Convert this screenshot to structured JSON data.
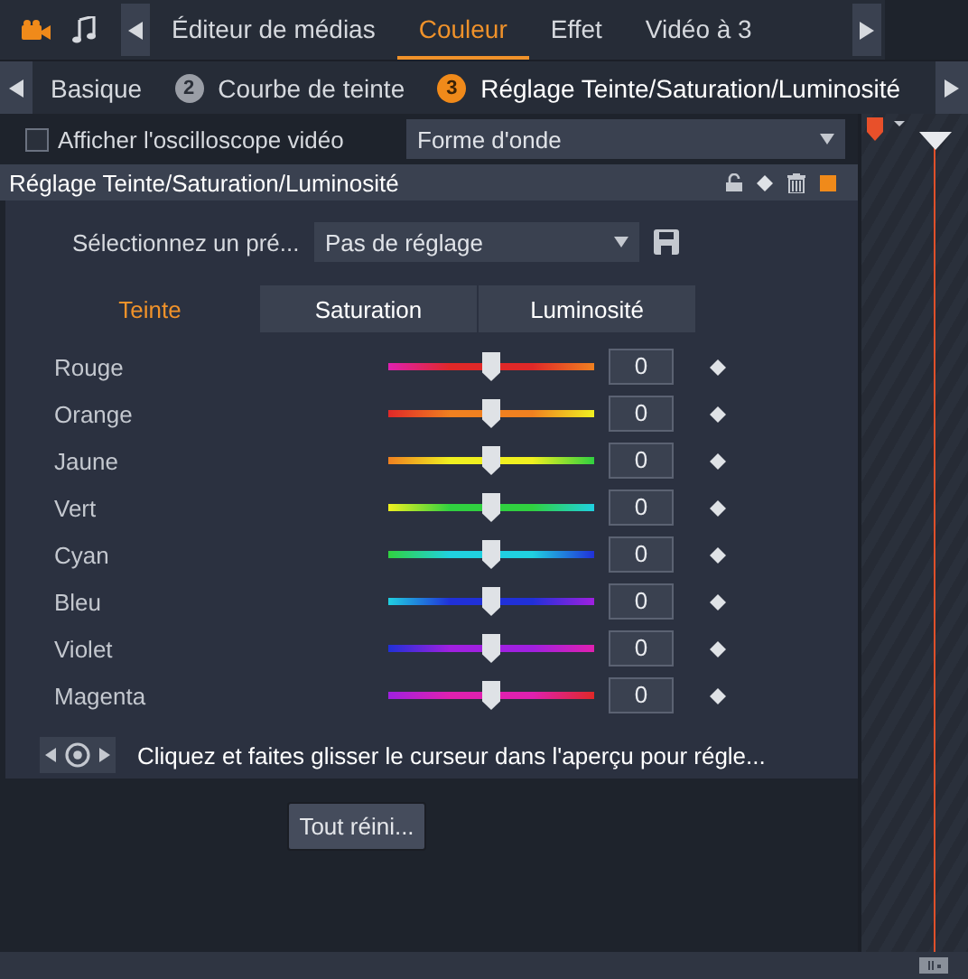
{
  "top_tabs": [
    {
      "label": "Éditeur de médias",
      "selected": false
    },
    {
      "label": "Couleur",
      "selected": true
    },
    {
      "label": "Effet",
      "selected": false
    },
    {
      "label": "Vidéo à 3",
      "selected": false
    }
  ],
  "sub_tabs": [
    {
      "label": "Basique",
      "selected": false
    },
    {
      "badge": "2",
      "label": "Courbe de teinte",
      "selected": false
    },
    {
      "badge": "3",
      "label": "Réglage Teinte/Saturation/Luminosité",
      "selected": true
    }
  ],
  "scope": {
    "label": "Afficher l'oscilloscope vidéo",
    "checked": false,
    "mode": "Forme d'onde"
  },
  "effect": {
    "title": "Réglage Teinte/Saturation/Luminosité",
    "preset_label": "Sélectionnez un pré...",
    "preset": "Pas de réglage",
    "mode_tabs": [
      {
        "label": "Teinte",
        "selected": true
      },
      {
        "label": "Saturation",
        "selected": false
      },
      {
        "label": "Luminosité",
        "selected": false
      }
    ],
    "sliders": [
      {
        "label": "Rouge",
        "level": 0.5,
        "value": "0",
        "color": "#e02828"
      },
      {
        "label": "Orange",
        "level": 0.5,
        "value": "0",
        "color": "#f08020"
      },
      {
        "label": "Jaune",
        "level": 0.5,
        "value": "0",
        "color": "#f0f020"
      },
      {
        "label": "Vert",
        "level": 0.5,
        "value": "0",
        "color": "#30d040"
      },
      {
        "label": "Cyan",
        "level": 0.5,
        "value": "0",
        "color": "#20d0e0"
      },
      {
        "label": "Bleu",
        "level": 0.5,
        "value": "0",
        "color": "#2030d8"
      },
      {
        "label": "Violet",
        "level": 0.5,
        "value": "0",
        "color": "#a020e0"
      },
      {
        "label": "Magenta",
        "level": 0.5,
        "value": "0",
        "color": "#e020b0"
      }
    ],
    "hint": "Cliquez et faites glisser le curseur dans l'aperçu pour régle...",
    "reset_button": "Tout réini..."
  }
}
